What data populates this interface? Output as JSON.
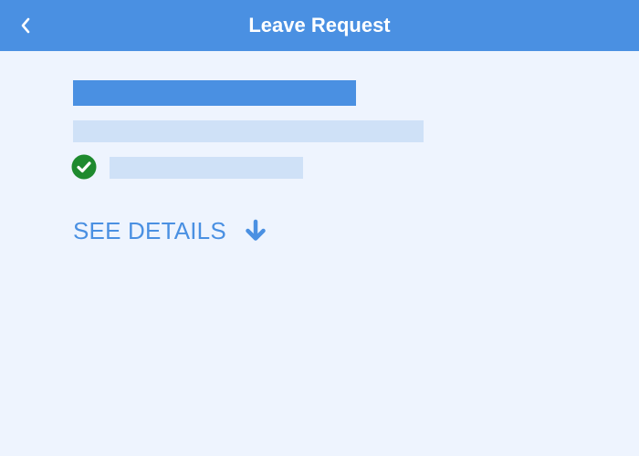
{
  "header": {
    "title": "Leave Request",
    "back_icon": "chevron-left-icon"
  },
  "request": {
    "status_icon": "check-circle-icon",
    "see_details_label": "SEE DETAILS",
    "see_details_icon": "arrow-down-icon"
  },
  "colors": {
    "header_bg": "#4A90E2",
    "page_bg": "#EEF4FE",
    "accent": "#4A90E2",
    "skeleton_light": "#CFE1F7",
    "success": "#1E8A2E"
  }
}
